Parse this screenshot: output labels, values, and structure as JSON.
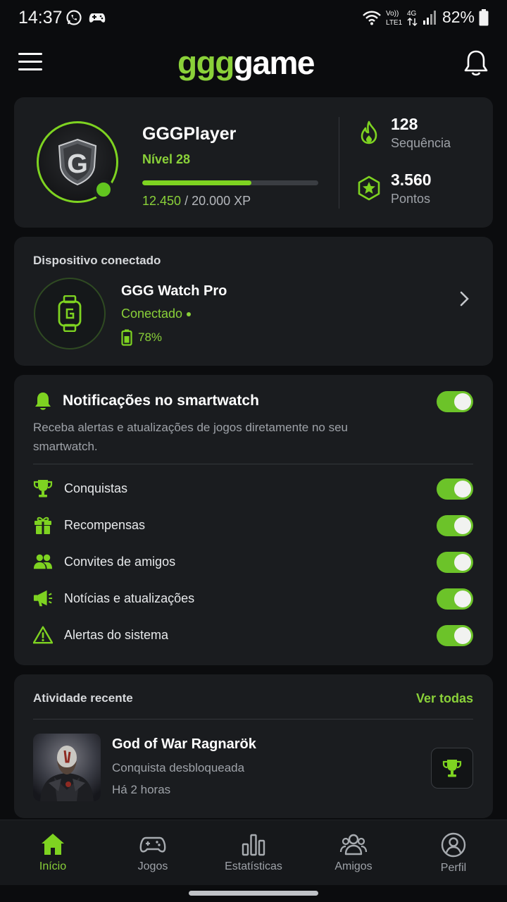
{
  "status_bar": {
    "time": "14:37",
    "battery": "82%",
    "icons": [
      "whatsapp-icon",
      "gamepad-icon",
      "wifi-icon",
      "volte-icon",
      "4g-icon",
      "signal-icon",
      "battery-icon"
    ],
    "network_label": "4G",
    "volte_label_top": "Vo))",
    "volte_label_bottom": "LTE1"
  },
  "header": {
    "logo_part1": "ggg",
    "logo_part2": "game",
    "menu_icon": "hamburger-menu-icon",
    "bell_icon": "bell-icon"
  },
  "profile": {
    "avatar_letter": "G",
    "name": "GGGPlayer",
    "level": "Nível 28",
    "xp_current": "12.450",
    "xp_total": " / 20.000 XP",
    "xp_progress": 0.62,
    "streak_value": "128",
    "streak_label": "Sequência",
    "points_value": "3.560",
    "points_label": "Pontos"
  },
  "device": {
    "section_title": "Dispositivo conectado",
    "name": "GGG Watch Pro",
    "status": "Conectado",
    "battery": "78%"
  },
  "notifications": {
    "title": "Notificações no smartwatch",
    "description": "Receba alertas e atualizações de jogos diretamente no seu smartwatch.",
    "master_enabled": true,
    "items": [
      {
        "label": "Conquistas",
        "icon": "trophy-icon",
        "enabled": true
      },
      {
        "label": "Recompensas",
        "icon": "gift-icon",
        "enabled": true
      },
      {
        "label": "Convites de amigos",
        "icon": "users-icon",
        "enabled": true
      },
      {
        "label": "Notícias e atualizações",
        "icon": "megaphone-icon",
        "enabled": true
      },
      {
        "label": "Alertas do sistema",
        "icon": "warning-icon",
        "enabled": true
      }
    ]
  },
  "activity": {
    "section_title": "Atividade recente",
    "see_all": "Ver todas",
    "item": {
      "title": "God of War Ragnarök",
      "subtitle": "Conquista desbloqueada",
      "time": "Há 2 horas"
    }
  },
  "bottom_nav": [
    {
      "label": "Início",
      "icon": "home-icon",
      "active": true
    },
    {
      "label": "Jogos",
      "icon": "gamepad-icon",
      "active": false
    },
    {
      "label": "Estatísticas",
      "icon": "bar-chart-icon",
      "active": false
    },
    {
      "label": "Amigos",
      "icon": "friends-icon",
      "active": false
    },
    {
      "label": "Perfil",
      "icon": "profile-icon",
      "active": false
    }
  ],
  "colors": {
    "accent": "#8ad139",
    "background": "#0b0c0e",
    "card": "#1a1c1f"
  }
}
